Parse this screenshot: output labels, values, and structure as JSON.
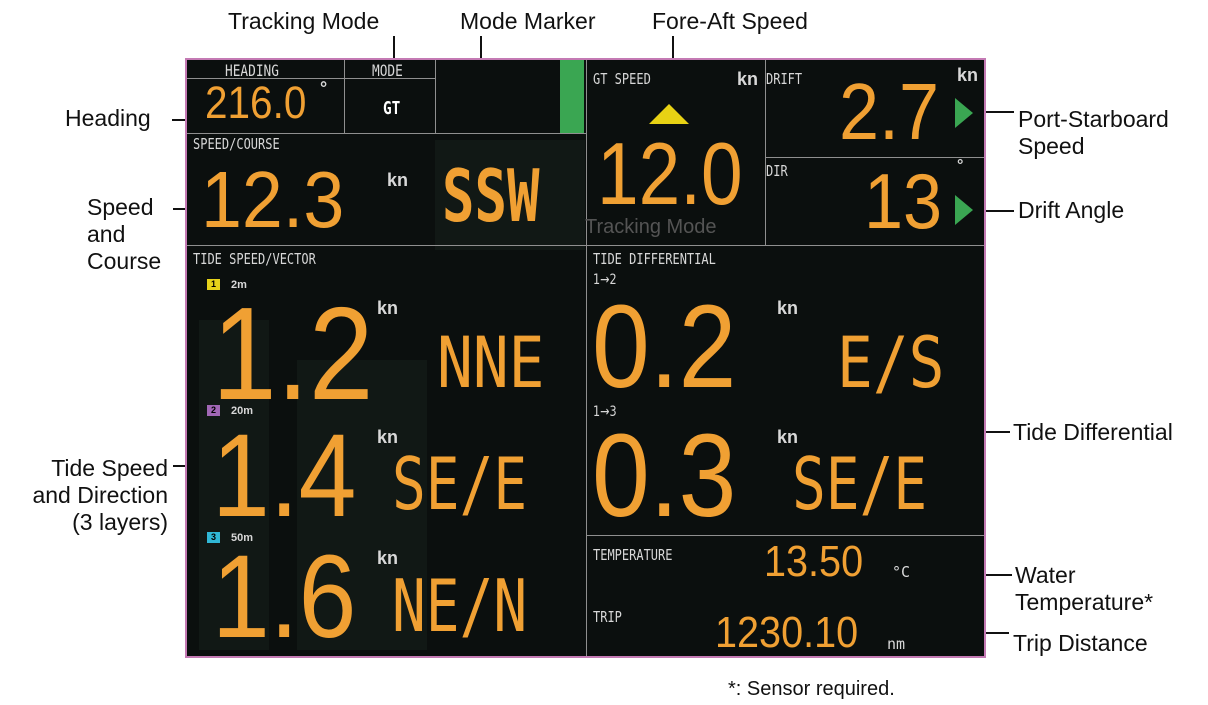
{
  "callouts": {
    "tracking_mode": "Tracking Mode",
    "mode_marker": "Mode Marker",
    "fore_aft_speed": "Fore-Aft Speed",
    "heading": "Heading",
    "port_starboard_1": "Port-Starboard",
    "port_starboard_2": "Speed",
    "speed_course_1": "Speed",
    "speed_course_2": "and",
    "speed_course_3": "Course",
    "drift_angle": "Drift Angle",
    "tide_diff": "Tide Differential",
    "tide_speed_1": "Tide Speed",
    "tide_speed_2": "and Direction",
    "tide_speed_3": "(3 layers)",
    "water_temp_1": "Water",
    "water_temp_2": "Temperature*",
    "trip_distance": "Trip Distance",
    "footnote": "*: Sensor required."
  },
  "screen": {
    "heading": {
      "label": "HEADING",
      "value": "216.0",
      "unit": "°"
    },
    "mode": {
      "label": "MODE",
      "value": "GT"
    },
    "marker_color": "#3aa652",
    "gt_speed": {
      "label": "GT SPEED",
      "unit": "kn",
      "value": "12.0",
      "arrow_color": "#e8d214"
    },
    "drift": {
      "label": "DRIFT",
      "unit": "kn",
      "value": "2.7",
      "arrow_color": "#3aa652"
    },
    "dir": {
      "label": "DIR",
      "unit": "°",
      "value": "13",
      "arrow_color": "#3aa652"
    },
    "watermark": "Tracking Mode",
    "speed_course": {
      "label": "SPEED/COURSE",
      "value": "12.3",
      "unit": "kn",
      "course": "SSW"
    },
    "tide": {
      "label": "TIDE SPEED/VECTOR",
      "layers": [
        {
          "num": "1",
          "depth": "2m",
          "value": "1.2",
          "unit": "kn",
          "dir": "NNE",
          "color": "#e6d21a"
        },
        {
          "num": "2",
          "depth": "20m",
          "value": "1.4",
          "unit": "kn",
          "dir": "SE/E",
          "color": "#a167b5"
        },
        {
          "num": "3",
          "depth": "50m",
          "value": "1.6",
          "unit": "kn",
          "dir": "NE/N",
          "color": "#30b7d6"
        }
      ]
    },
    "diff": {
      "label": "TIDE DIFFERENTIAL",
      "rows": [
        {
          "pair": "1→2",
          "value": "0.2",
          "unit": "kn",
          "dir": "E/S"
        },
        {
          "pair": "1→3",
          "value": "0.3",
          "unit": "kn",
          "dir": "SE/E"
        }
      ]
    },
    "temperature": {
      "label": "TEMPERATURE",
      "value": "13.50",
      "unit": "°C"
    },
    "trip": {
      "label": "TRIP",
      "value": "1230.10",
      "unit": "nm"
    }
  }
}
